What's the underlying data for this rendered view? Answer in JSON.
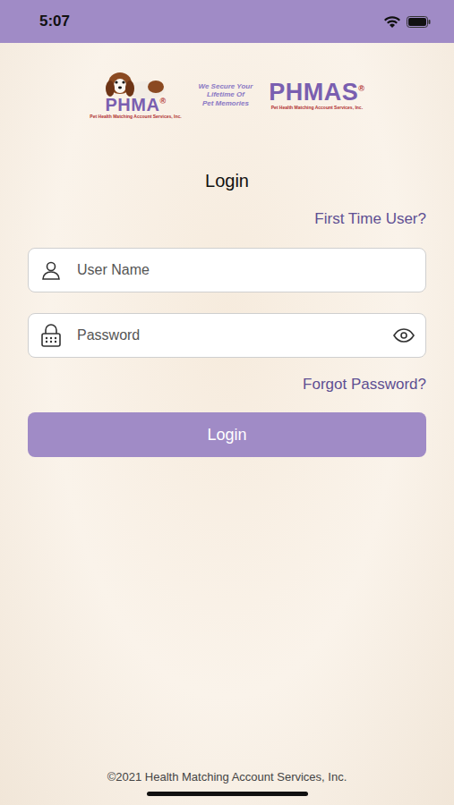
{
  "status_bar": {
    "time": "5:07"
  },
  "logos": {
    "left": {
      "name": "PHMA",
      "mark": "®",
      "subtitle": "Pet Health Matching Account Services, Inc."
    },
    "tagline": [
      "We Secure Your",
      "Lifetime Of",
      "Pet Memories"
    ],
    "right": {
      "name": "PHMAS",
      "mark": "®",
      "subtitle": "Pet Health Matching Account Services, Inc."
    }
  },
  "title": "Login",
  "first_time_link": "First Time User?",
  "fields": [
    {
      "kind": "text",
      "placeholder": "User Name"
    },
    {
      "kind": "password",
      "placeholder": "Password"
    }
  ],
  "forgot_link": "Forgot Password?",
  "button": "Login",
  "footer": "©2021 Health Matching Account Services, Inc."
}
